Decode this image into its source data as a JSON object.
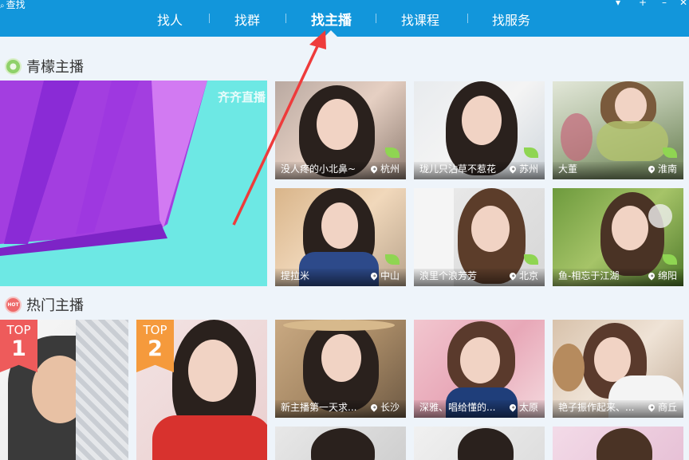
{
  "window": {
    "title": "查找",
    "title_icon": "search-icon"
  },
  "nav": {
    "tabs": [
      {
        "label": "找人",
        "active": false
      },
      {
        "label": "找群",
        "active": false
      },
      {
        "label": "找主播",
        "active": true
      },
      {
        "label": "找课程",
        "active": false
      },
      {
        "label": "找服务",
        "active": false
      }
    ]
  },
  "window_controls": [
    "feedback-icon",
    "plus-icon",
    "minimize-icon",
    "close-icon"
  ],
  "sections": {
    "qingmeng": {
      "title": "青檬主播",
      "icon": "lime-icon"
    },
    "hot": {
      "title": "热门主播",
      "icon": "hot-icon"
    }
  },
  "banner": {
    "watermark": "齐齐直播"
  },
  "qingmeng_cards": [
    {
      "name": "没人疼的小北鼻~",
      "location": "杭州",
      "leaf": true
    },
    {
      "name": "珑儿只沾草不惹花",
      "location": "苏州",
      "leaf": true
    },
    {
      "name": "大董",
      "location": "淮南",
      "leaf": true
    },
    {
      "name": "提拉米",
      "location": "中山",
      "leaf": true
    },
    {
      "name": "浪里个浪芳芳",
      "location": "北京",
      "leaf": true
    },
    {
      "name": "鱼-相忘于江湖",
      "location": "绵阳",
      "leaf": true
    }
  ],
  "hot_top": [
    {
      "badge_text": "TOP",
      "rank": "1",
      "badge_color": "#ee5b5b"
    },
    {
      "badge_text": "TOP",
      "rank": "2",
      "badge_color": "#f59a3c"
    }
  ],
  "hot_cards": [
    {
      "name": "新主播第一天求...",
      "location": "长沙"
    },
    {
      "name": "深雅、唱给懂的...",
      "location": "太原"
    },
    {
      "name": "艳子振作起来、...",
      "location": "商丘"
    }
  ],
  "colors": {
    "header": "#1296db",
    "background": "#eef4fa",
    "accent_leaf": "#8fd552",
    "annotation_arrow": "#ee3b3b"
  }
}
